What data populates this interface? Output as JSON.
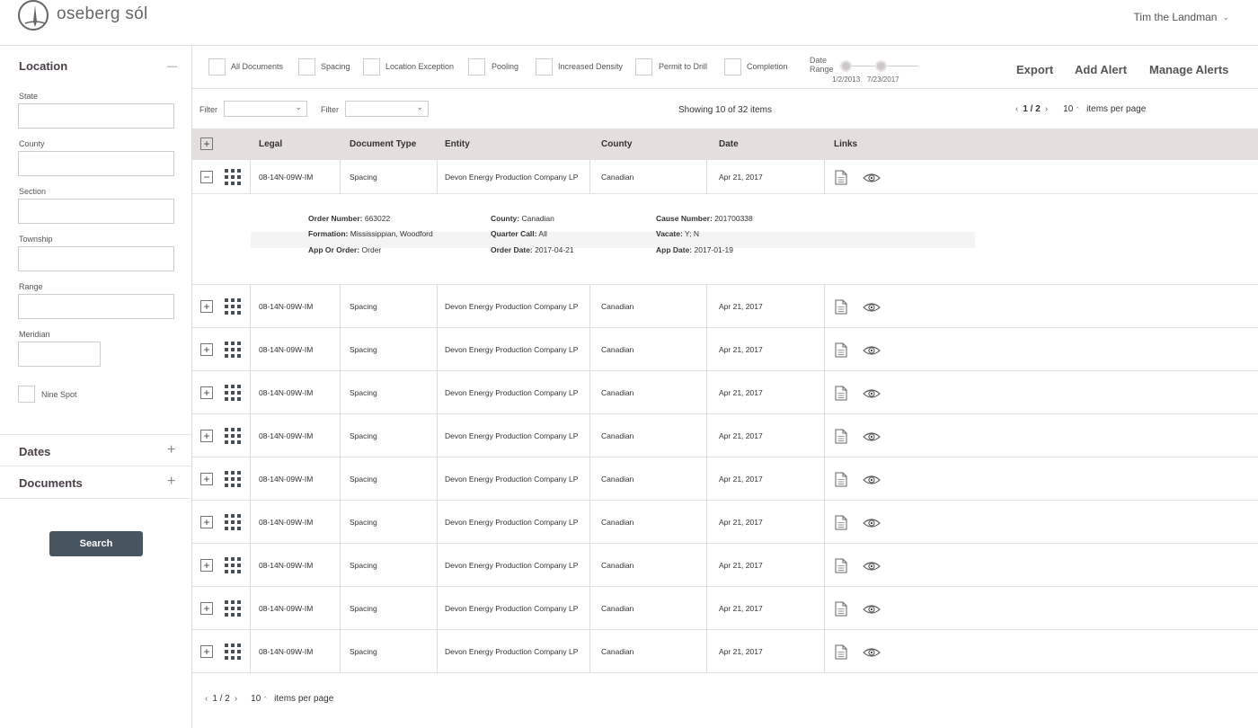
{
  "app": {
    "logo_text": "oseberg sól",
    "user_name": "Tim the Landman",
    "user_chevron": "⌄"
  },
  "sidebar": {
    "location": {
      "title": "Location",
      "toggle": "—"
    },
    "fields": [
      {
        "label": "State",
        "value": ""
      },
      {
        "label": "County",
        "value": ""
      },
      {
        "label": "Section",
        "value": ""
      },
      {
        "label": "Township",
        "value": ""
      },
      {
        "label": "Range",
        "value": ""
      },
      {
        "label": "Meridian",
        "value": ""
      }
    ],
    "nine_spot": "Nine Spot",
    "dates": {
      "title": "Dates",
      "toggle": "+"
    },
    "documents": {
      "title": "Documents",
      "toggle": "+"
    },
    "search_label": "Search"
  },
  "toolbar": {
    "doc_types": [
      "All Documents",
      "Spacing",
      "Location Exception",
      "Pooling",
      "Increased Density",
      "Permit to Drill",
      "Completion"
    ],
    "date_range_label_1": "Date",
    "date_range_label_2": "Range",
    "start_date": "1/2/2013",
    "end_date": "7/23/2017",
    "export": "Export",
    "add_alert": "Add Alert",
    "manage_alerts": "Manage Alerts"
  },
  "filters": {
    "label": "Filter",
    "caret": "⌄",
    "showing_prefix": "Showing",
    "showing_text": "10 of 32 items"
  },
  "pager": {
    "prev": "‹",
    "next": "›",
    "page": "1 / 2",
    "per_page_value": "10",
    "per_page_spinner": "⌃",
    "per_page_label": "items per page"
  },
  "table": {
    "headers": [
      "Legal",
      "Document Type",
      "Entity",
      "County",
      "Date",
      "Links"
    ],
    "header_expand": "+",
    "rows": [
      {
        "expand": "−",
        "legal": "08-14N-09W-IM",
        "doc_type": "Spacing",
        "entity": "Devon Energy Production Company LP",
        "county": "Canadian",
        "date": "Apr 21, 2017"
      },
      {
        "expand": "+",
        "legal": "08-14N-09W-IM",
        "doc_type": "Spacing",
        "entity": "Devon Energy Production Company LP",
        "county": "Canadian",
        "date": "Apr 21, 2017"
      },
      {
        "expand": "+",
        "legal": "08-14N-09W-IM",
        "doc_type": "Spacing",
        "entity": "Devon Energy Production Company LP",
        "county": "Canadian",
        "date": "Apr 21, 2017"
      },
      {
        "expand": "+",
        "legal": "08-14N-09W-IM",
        "doc_type": "Spacing",
        "entity": "Devon Energy Production Company LP",
        "county": "Canadian",
        "date": "Apr 21, 2017"
      },
      {
        "expand": "+",
        "legal": "08-14N-09W-IM",
        "doc_type": "Spacing",
        "entity": "Devon Energy Production Company LP",
        "county": "Canadian",
        "date": "Apr 21, 2017"
      },
      {
        "expand": "+",
        "legal": "08-14N-09W-IM",
        "doc_type": "Spacing",
        "entity": "Devon Energy Production Company LP",
        "county": "Canadian",
        "date": "Apr 21, 2017"
      },
      {
        "expand": "+",
        "legal": "08-14N-09W-IM",
        "doc_type": "Spacing",
        "entity": "Devon Energy Production Company LP",
        "county": "Canadian",
        "date": "Apr 21, 2017"
      },
      {
        "expand": "+",
        "legal": "08-14N-09W-IM",
        "doc_type": "Spacing",
        "entity": "Devon Energy Production Company LP",
        "county": "Canadian",
        "date": "Apr 21, 2017"
      },
      {
        "expand": "+",
        "legal": "08-14N-09W-IM",
        "doc_type": "Spacing",
        "entity": "Devon Energy Production Company LP",
        "county": "Canadian",
        "date": "Apr 21, 2017"
      },
      {
        "expand": "+",
        "legal": "08-14N-09W-IM",
        "doc_type": "Spacing",
        "entity": "Devon Energy Production Company LP",
        "county": "Canadian",
        "date": "Apr 21, 2017"
      }
    ],
    "detail": [
      {
        "label": "Order Number:",
        "value": "663022"
      },
      {
        "label": "County:",
        "value": "Canadian"
      },
      {
        "label": "Cause Number:",
        "value": "201700338"
      },
      {
        "label": "Formation:",
        "value": "Mississippian, Woodford"
      },
      {
        "label": "Quarter Call:",
        "value": "All"
      },
      {
        "label": "Vacate:",
        "value": "Y; N"
      },
      {
        "label": "App Or Order:",
        "value": "Order"
      },
      {
        "label": "Order Date:",
        "value": "2017-04-21"
      },
      {
        "label": "App Date:",
        "value": "2017-01-19"
      }
    ]
  },
  "colors": {
    "header_bg": "#e4dfdc",
    "button_bg": "#465560",
    "icon_dark": "#444f58"
  }
}
